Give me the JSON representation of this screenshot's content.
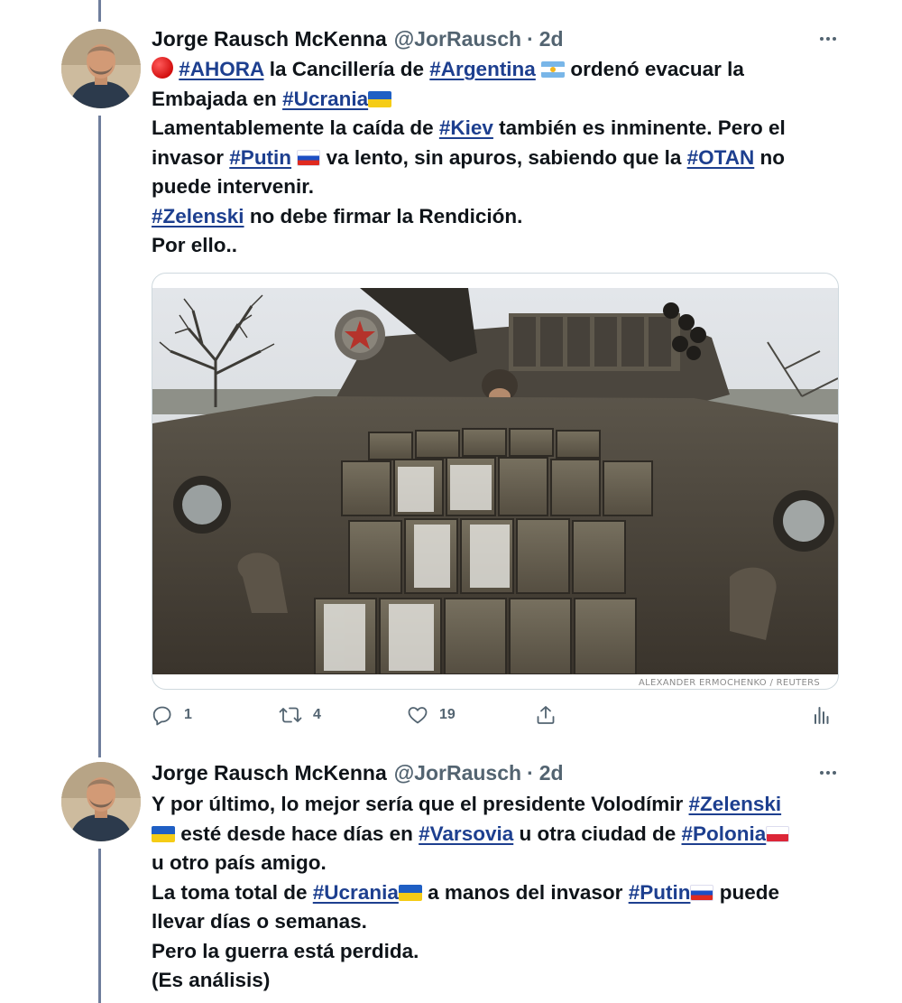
{
  "colors": {
    "hashtag": "#1d3f8f",
    "thread_line": "#6f7e9c",
    "secondary_text": "#536471"
  },
  "icons": [
    "more-icon",
    "reply-icon",
    "retweet-icon",
    "like-icon",
    "share-icon",
    "analytics-icon"
  ],
  "tweets": [
    {
      "author": {
        "name": "Jorge Rausch McKenna",
        "handle": "@JorRausch",
        "separator": "·",
        "time": "2d"
      },
      "text": {
        "l1": {
          "hash_ahora": "#AHORA",
          "t1": " la Cancillería de ",
          "hash_argentina": "#Argentina",
          "t2": " ordenó evacuar la"
        },
        "l2": {
          "t1": "Embajada en ",
          "hash_ucrania": "#Ucrania"
        },
        "l3": {
          "t1": "Lamentablemente la caída de ",
          "hash_kiev": "#Kiev",
          "t2": " también es inminente. Pero el"
        },
        "l4": {
          "t1": "invasor ",
          "hash_putin": "#Putin",
          "t2": " va lento, sin apuros, sabiendo que la ",
          "hash_otan": "#OTAN",
          "t3": " no"
        },
        "l5": {
          "t1": "puede intervenir."
        },
        "l6": {
          "hash_zelenski": "#Zelenski",
          "t1": " no debe firmar la Rendición."
        },
        "l7": {
          "t1": "Por ello.."
        }
      },
      "media": {
        "credit": "ALEXANDER ERMOCHENKO  /  REUTERS"
      },
      "stats": {
        "replies": "1",
        "retweets": "4",
        "likes": "19"
      }
    },
    {
      "author": {
        "name": "Jorge Rausch McKenna",
        "handle": "@JorRausch",
        "separator": "·",
        "time": "2d"
      },
      "text": {
        "l1": {
          "t1": "Y por último, lo mejor sería que el presidente Volodímir ",
          "hash_zelenski": "#Zelenski"
        },
        "l2": {
          "t1": " esté desde hace días en ",
          "hash_varsovia": "#Varsovia",
          "t2": " u otra ciudad de ",
          "hash_polonia": "#Polonia"
        },
        "l3": {
          "t1": "u otro país amigo."
        },
        "l4": {
          "t1": "La toma total de ",
          "hash_ucrania": "#Ucrania",
          "t2": " a manos del invasor ",
          "hash_putin": "#Putin",
          "t3": " puede"
        },
        "l5": {
          "t1": "llevar días o semanas."
        },
        "l6": {
          "t1": "Pero la guerra está perdida."
        },
        "l7": {
          "t1": "(Es análisis)"
        }
      }
    }
  ]
}
